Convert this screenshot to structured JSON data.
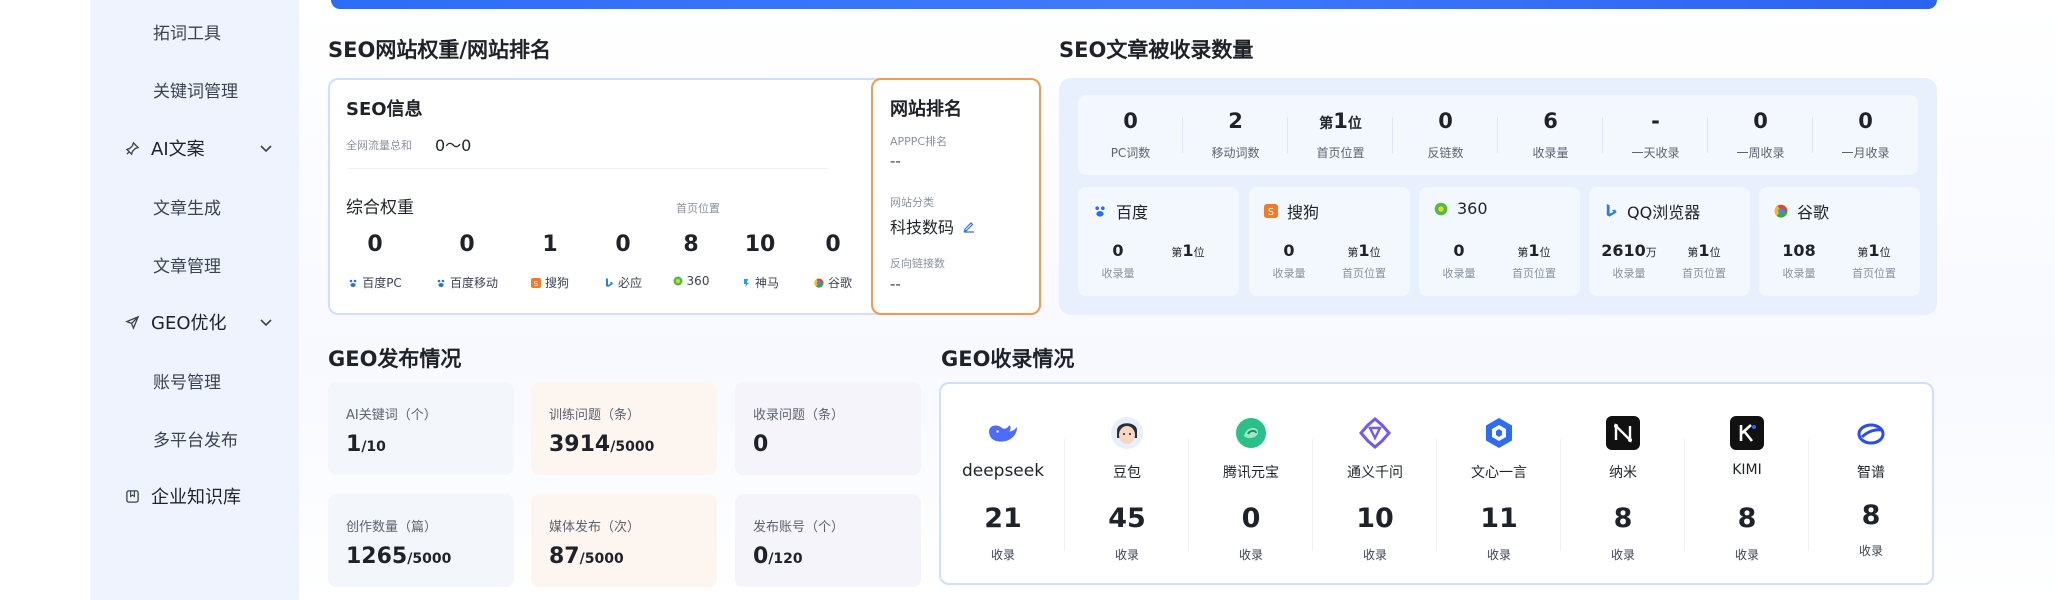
{
  "sidebar": {
    "items": [
      {
        "label": "拓词工具"
      },
      {
        "label": "关键词管理"
      },
      {
        "label": "AI文案",
        "icon": "pin-icon"
      },
      {
        "label": "文章生成"
      },
      {
        "label": "文章管理"
      },
      {
        "label": "GEO优化",
        "icon": "send-icon"
      },
      {
        "label": "账号管理"
      },
      {
        "label": "多平台发布"
      },
      {
        "label": "企业知识库",
        "icon": "book-icon"
      }
    ]
  },
  "seo_weight": {
    "title": "SEO网站权重/网站排名",
    "info_title": "SEO信息",
    "traffic_label": "全网流量总和",
    "traffic_value": "0～0",
    "weight_title": "综合权重",
    "first_page_label": "首页位置",
    "engines": [
      {
        "value": "0",
        "name": "百度PC",
        "icon": "baidu-icon"
      },
      {
        "value": "0",
        "name": "百度移动",
        "icon": "baidu-icon"
      },
      {
        "value": "1",
        "name": "搜狗",
        "icon": "sogou-icon"
      },
      {
        "value": "0",
        "name": "必应",
        "icon": "bing-icon"
      },
      {
        "value": "8",
        "name": "360",
        "icon": "360-icon"
      },
      {
        "value": "10",
        "name": "神马",
        "icon": "shenma-icon"
      },
      {
        "value": "0",
        "name": "谷歌",
        "icon": "google-icon"
      }
    ],
    "rank": {
      "title": "网站排名",
      "apppc_label": "APPPC排名",
      "apppc_value": "--",
      "category_label": "网站分类",
      "category_value": "科技数码",
      "backlink_label": "反向链接数",
      "backlink_value": "--"
    }
  },
  "seo_included": {
    "title": "SEO文章被收录数量",
    "stats": [
      {
        "prefix": "",
        "value": "0",
        "suffix": "",
        "label": "PC词数"
      },
      {
        "prefix": "",
        "value": "2",
        "suffix": "",
        "label": "移动词数"
      },
      {
        "prefix": "第",
        "value": "1",
        "suffix": "位",
        "label": "首页位置"
      },
      {
        "prefix": "",
        "value": "0",
        "suffix": "",
        "label": "反链数"
      },
      {
        "prefix": "",
        "value": "6",
        "suffix": "",
        "label": "收录量"
      },
      {
        "prefix": "",
        "value": "-",
        "suffix": "",
        "label": "一天收录"
      },
      {
        "prefix": "",
        "value": "0",
        "suffix": "",
        "label": "一周收录"
      },
      {
        "prefix": "",
        "value": "0",
        "suffix": "",
        "label": "一月收录"
      }
    ],
    "engines": [
      {
        "name": "百度",
        "icon": "baidu-icon",
        "count": "0",
        "count_unit": "",
        "count_label": "收录量",
        "rank_prefix": "第",
        "rank": "1",
        "rank_suffix": "位",
        "rank_label": ""
      },
      {
        "name": "搜狗",
        "icon": "sogou-icon",
        "count": "0",
        "count_unit": "",
        "count_label": "收录量",
        "rank_prefix": "第",
        "rank": "1",
        "rank_suffix": "位",
        "rank_label": "首页位置"
      },
      {
        "name": "360",
        "icon": "360-icon",
        "count": "0",
        "count_unit": "",
        "count_label": "收录量",
        "rank_prefix": "第",
        "rank": "1",
        "rank_suffix": "位",
        "rank_label": "首页位置"
      },
      {
        "name": "QQ浏览器",
        "icon": "bing-icon",
        "count": "2610",
        "count_unit": "万",
        "count_label": "收录量",
        "rank_prefix": "第",
        "rank": "1",
        "rank_suffix": "位",
        "rank_label": "首页位置"
      },
      {
        "name": "谷歌",
        "icon": "google-icon",
        "count": "108",
        "count_unit": "",
        "count_label": "收录量",
        "rank_prefix": "第",
        "rank": "1",
        "rank_suffix": "位",
        "rank_label": "首页位置"
      }
    ]
  },
  "geo_publish": {
    "title": "GEO发布情况",
    "cards": [
      {
        "label": "AI关键词（个）",
        "value": "1",
        "total": "/10",
        "bg": "#f3f6fb"
      },
      {
        "label": "训练问题（条）",
        "value": "3914",
        "total": "/5000",
        "bg": "#fdf6f0"
      },
      {
        "label": "收录问题（条）",
        "value": "0",
        "total": "",
        "bg": "#f4f4fa"
      },
      {
        "label": "创作数量（篇）",
        "value": "1265",
        "total": "/5000",
        "bg": "#f3f6fb"
      },
      {
        "label": "媒体发布（次）",
        "value": "87",
        "total": "/5000",
        "bg": "#fdf6f0"
      },
      {
        "label": "发布账号（个）",
        "value": "0",
        "total": "/120",
        "bg": "#f4f4fa"
      }
    ]
  },
  "geo_included": {
    "title": "GEO收录情况",
    "platforms": [
      {
        "name": "deepseek",
        "value": "21",
        "label": "收录",
        "icon": "deepseek-icon",
        "color": "#4d6bfe"
      },
      {
        "name": "豆包",
        "value": "45",
        "label": "收录",
        "icon": "doubao-icon",
        "color": "#f5c6a5"
      },
      {
        "name": "腾讯元宝",
        "value": "0",
        "label": "收录",
        "icon": "yuanbao-icon",
        "color": "#2bbf8a"
      },
      {
        "name": "通义千问",
        "value": "10",
        "label": "收录",
        "icon": "tongyi-icon",
        "color": "#6e5bf6"
      },
      {
        "name": "文心一言",
        "value": "11",
        "label": "收录",
        "icon": "wenxin-icon",
        "color": "#2d6df6"
      },
      {
        "name": "纳米",
        "value": "8",
        "label": "收录",
        "icon": "nami-icon",
        "color": "#111111"
      },
      {
        "name": "KIMI",
        "value": "8",
        "label": "收录",
        "icon": "kimi-icon",
        "color": "#111111"
      },
      {
        "name": "智谱",
        "value": "8",
        "label": "收录",
        "icon": "zhipu-icon",
        "color": "#2d4cf0"
      }
    ]
  }
}
